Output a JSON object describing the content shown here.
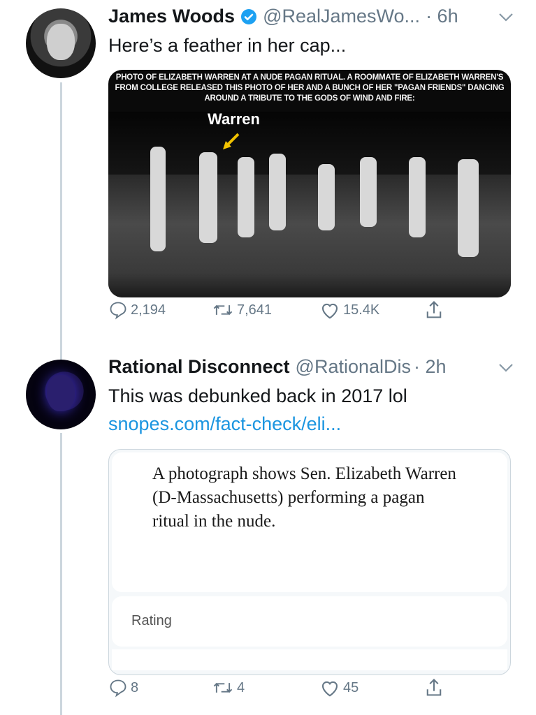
{
  "tweets": [
    {
      "name": "James Woods",
      "handle": "@RealJamesWo...",
      "time": "· 6h",
      "verified": true,
      "text": "Here’s a feather in her cap...",
      "media": {
        "caption": "Photo of Elizabeth Warren at a nude pagan ritual. A roommate of Elizabeth Warren's from college released this photo of her and a bunch of her \"pagan friends\" dancing around a tribute to the gods of wind and fire:",
        "label": "Warren"
      },
      "stats": {
        "replies": "2,194",
        "retweets": "7,641",
        "likes": "15.4K"
      }
    },
    {
      "name": "Rational Disconnect",
      "handle": "@RationalDis",
      "time": "· 2h",
      "verified": false,
      "text": "This was debunked back in 2017 lol",
      "link": "snopes.com/fact-check/eli...",
      "card": {
        "claim": "A photograph shows Sen. Elizabeth Warren (D-Massachusetts) performing a pagan ritual in the nude.",
        "rating_label": "Rating"
      },
      "stats": {
        "replies": "8",
        "retweets": "4",
        "likes": "45"
      }
    }
  ],
  "colors": {
    "accent": "#1b95e0",
    "secondary_text": "#657786",
    "thread_line": "#ccd6dd"
  },
  "icons": [
    "reply-icon",
    "retweet-icon",
    "like-icon",
    "share-icon",
    "verified-badge-icon",
    "chevron-down-icon"
  ]
}
